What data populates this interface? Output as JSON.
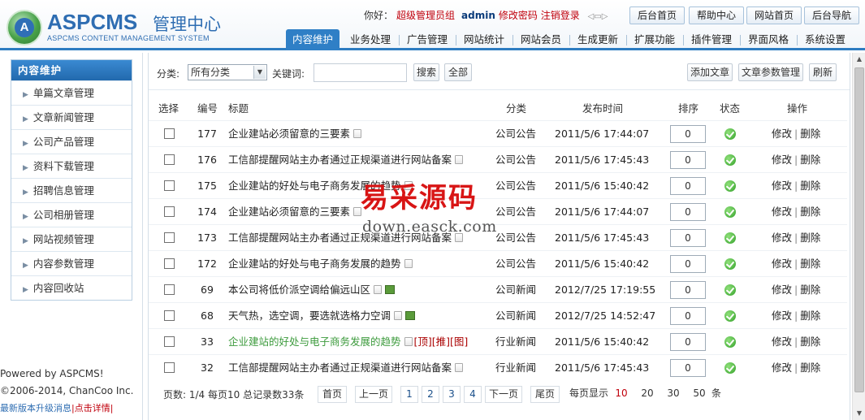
{
  "header": {
    "logo_icon_letter": "A",
    "logo_title": "ASPCMS",
    "logo_title_cn": "管理中心",
    "logo_subtitle": "ASPCMS CONTENT MANAGEMENT SYSTEM",
    "greeting": "你好：",
    "role": "超级管理员组",
    "username": "admin",
    "change_password": "修改密码",
    "logout": "注销登录",
    "top_buttons": [
      "后台首页",
      "帮助中心",
      "网站首页",
      "后台导航"
    ],
    "nav_tabs": [
      "内容维护",
      "业务处理",
      "广告管理",
      "网站统计",
      "网站会员",
      "生成更新",
      "扩展功能",
      "插件管理",
      "界面风格",
      "系统设置"
    ],
    "active_tab": "内容维护"
  },
  "sidebar": {
    "title": "内容维护",
    "items": [
      "单篇文章管理",
      "文章新闻管理",
      "公司产品管理",
      "资料下载管理",
      "招聘信息管理",
      "公司相册管理",
      "网站视频管理",
      "内容参数管理",
      "内容回收站"
    ],
    "powered_by": "Powered by ASPCMS!",
    "copyright": "©2006-2014, ChanCoo Inc.",
    "update_notice": "最新版本升级消息",
    "update_link": "|点击详情|"
  },
  "toolbar": {
    "category_label": "分类:",
    "category_value": "所有分类",
    "keyword_label": "关键词:",
    "keyword_value": "",
    "search_button": "搜索",
    "all_button": "全部",
    "add_article_button": "添加文章",
    "article_params_button": "文章参数管理",
    "refresh_button": "刷新"
  },
  "table": {
    "headers": [
      "选择",
      "编号",
      "标题",
      "分类",
      "发布时间",
      "排序",
      "状态",
      "操作"
    ],
    "edit_label": "修改",
    "op_separator": "|",
    "delete_label": "删除",
    "rows": [
      {
        "id": "177",
        "title": "企业建站必须留意的三要素",
        "category": "公司公告",
        "date": "2011/5/6 17:44:07",
        "order": "0",
        "image": false,
        "green": false,
        "tags": ""
      },
      {
        "id": "176",
        "title": "工信部提醒网站主办者通过正规渠道进行网站备案",
        "category": "公司公告",
        "date": "2011/5/6 17:45:43",
        "order": "0",
        "image": false,
        "green": false,
        "tags": ""
      },
      {
        "id": "175",
        "title": "企业建站的好处与电子商务发展的趋势",
        "category": "公司公告",
        "date": "2011/5/6 15:40:42",
        "order": "0",
        "image": false,
        "green": false,
        "tags": ""
      },
      {
        "id": "174",
        "title": "企业建站必须留意的三要素",
        "category": "公司公告",
        "date": "2011/5/6 17:44:07",
        "order": "0",
        "image": false,
        "green": false,
        "tags": ""
      },
      {
        "id": "173",
        "title": "工信部提醒网站主办者通过正规渠道进行网站备案",
        "category": "公司公告",
        "date": "2011/5/6 17:45:43",
        "order": "0",
        "image": false,
        "green": false,
        "tags": ""
      },
      {
        "id": "172",
        "title": "企业建站的好处与电子商务发展的趋势",
        "category": "公司公告",
        "date": "2011/5/6 15:40:42",
        "order": "0",
        "image": false,
        "green": false,
        "tags": ""
      },
      {
        "id": "69",
        "title": "本公司将低价派空调给偏远山区",
        "category": "公司新闻",
        "date": "2012/7/25 17:19:55",
        "order": "0",
        "image": true,
        "green": false,
        "tags": ""
      },
      {
        "id": "68",
        "title": "天气热，选空调，要选就选格力空调",
        "category": "公司新闻",
        "date": "2012/7/25 14:52:47",
        "order": "0",
        "image": true,
        "green": false,
        "tags": ""
      },
      {
        "id": "33",
        "title": "企业建站的好处与电子商务发展的趋势",
        "category": "行业新闻",
        "date": "2011/5/6 15:40:42",
        "order": "0",
        "image": false,
        "green": true,
        "tags": "[顶][推][图]"
      },
      {
        "id": "32",
        "title": "工信部提醒网站主办者通过正规渠道进行网站备案",
        "category": "行业新闻",
        "date": "2011/5/6 17:45:43",
        "order": "0",
        "image": false,
        "green": false,
        "tags": ""
      }
    ]
  },
  "pager": {
    "summary": "页数: 1/4 每页10 总记录数33条",
    "first": "首页",
    "prev": "上一页",
    "pages": [
      "1",
      "2",
      "3",
      "4"
    ],
    "next": "下一页",
    "last": "尾页",
    "per_page_label": "每页显示",
    "sizes": [
      "10",
      "20",
      "30",
      "50"
    ],
    "current_size": "10",
    "unit": "条"
  },
  "watermark": {
    "line1": "易采源码",
    "line2": "down.easck.com"
  }
}
